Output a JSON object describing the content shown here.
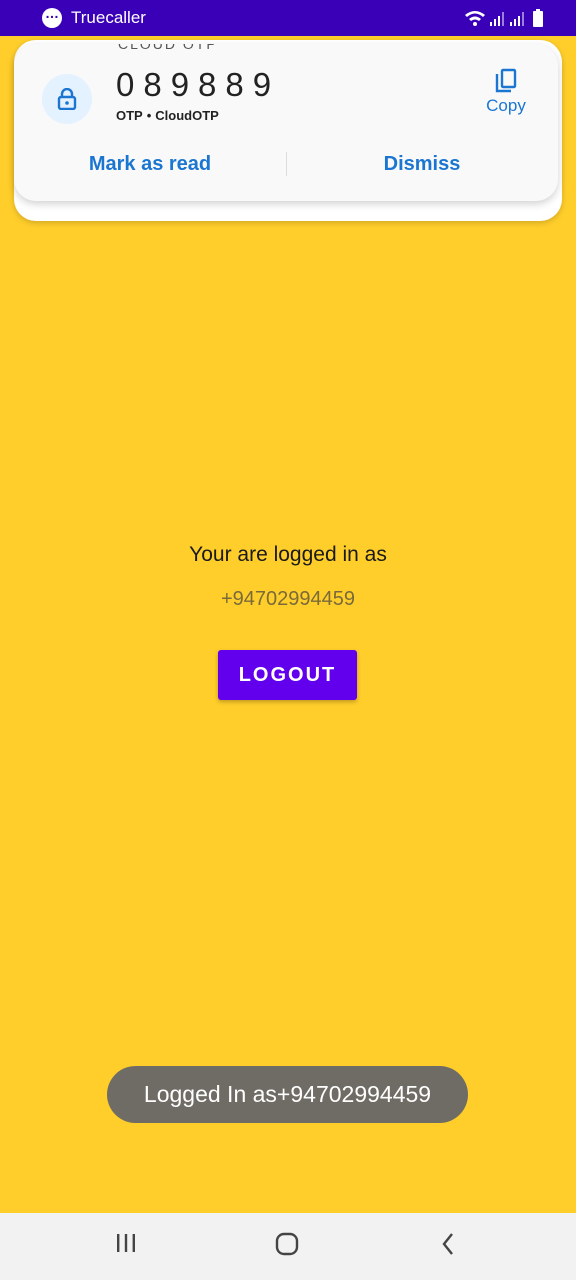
{
  "status_bar": {
    "app_name": "Truecaller",
    "app_icon": "chat-bubble-icon",
    "icons": [
      "wifi-icon",
      "signal-icon",
      "signal-icon",
      "battery-icon"
    ],
    "background_color": "#3A00B8"
  },
  "notification": {
    "peek_text": "CLOUD OTP",
    "otp_code": "089889",
    "label": "OTP",
    "separator": "•",
    "source": "CloudOTP",
    "copy_label": "Copy",
    "mark_as_read_label": "Mark as read",
    "dismiss_label": "Dismiss",
    "accent_color": "#1B76D2"
  },
  "main": {
    "logged_in_text": "Your are logged in as",
    "phone_number": "+94702994459",
    "logout_label": "LOGOUT",
    "background_color": "#FFCE2B",
    "button_color": "#6200EE"
  },
  "toast": {
    "message": "Logged In as+94702994459"
  },
  "nav_bar": {
    "recents_icon": "recents-icon",
    "home_icon": "home-icon",
    "back_icon": "back-icon"
  }
}
